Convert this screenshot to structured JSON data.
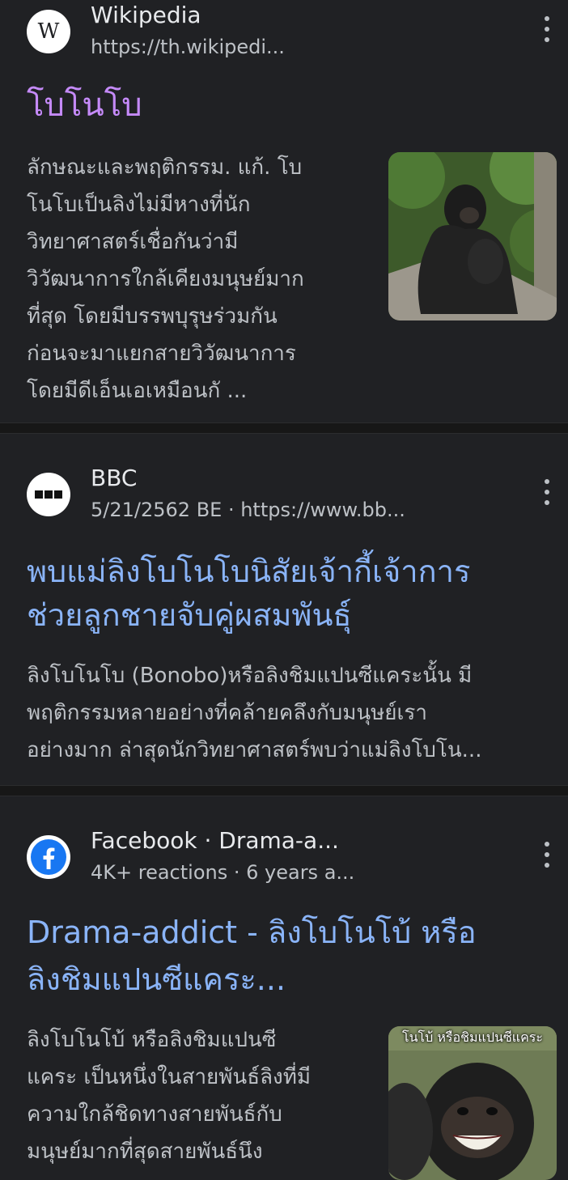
{
  "results": [
    {
      "site": "Wikipedia",
      "meta": "https://th.wikipedi...",
      "favicon": "W",
      "title": "โบโนโบ",
      "snippet_lines": [
        "ลักษณะและพฤติกรรม. แก้. โบ",
        "โนโบเป็นลิงไม่มีหางที่นัก",
        "วิทยาศาสตร์เชื่อกันว่ามี",
        "วิวัฒนาการใกล้เคียงมนุษย์มาก",
        "ที่สุด โดยมีบรรพบุรุษร่วมกัน",
        "ก่อนจะมาแยกสายวิวัฒนาการ",
        "โดยมีดีเอ็นเอเหมือนกั ..."
      ],
      "thumbnail": "bonobo-sitting-photo"
    },
    {
      "site": "BBC",
      "meta": "5/21/2562 BE · https://www.bb...",
      "favicon": "bbc-logo",
      "title_lines": [
        "พบแม่ลิงโบโนโบนิสัยเจ้ากี้เจ้าการ",
        "ช่วยลูกชายจับคู่ผสมพันธุ์"
      ],
      "snippet_lines": [
        "ลิงโบโนโบ (Bonobo)หรือลิงชิมแปนซีแคระนั้น มี",
        "พฤติกรรมหลายอย่างที่คล้ายคลึงกับมนุษย์เรา",
        "อย่างมาก ล่าสุดนักวิทยาศาสตร์พบว่าแม่ลิงโบโน..."
      ]
    },
    {
      "site": "Facebook · Drama-a...",
      "meta": "4K+ reactions · 6 years a...",
      "favicon": "facebook-logo",
      "title_lines": [
        "Drama-addict - ลิงโบโนโบ้ หรือ",
        "ลิงชิมแปนซีแคระ..."
      ],
      "snippet_lines": [
        "ลิงโบโนโบ้ หรือลิงชิมแปนซี",
        "แคระ เป็นหนึ่งในสายพันธ์ลิงที่มี",
        "ความใกล้ชิดทางสายพันธ์กับ",
        "มนุษย์มากที่สุดสายพันธ์นึง"
      ],
      "thumbnail_caption": "โนโบ้ หรือชิมแปนซีแคระ",
      "thumbnail": "smiling-bonobo-photo"
    }
  ],
  "colors": {
    "background": "#202124",
    "link": "#8ab4f8",
    "visited_link": "#c58af9",
    "text": "#bdc1c6",
    "facebook_blue": "#1877f2"
  },
  "icons": [
    "more-vert-icon"
  ]
}
